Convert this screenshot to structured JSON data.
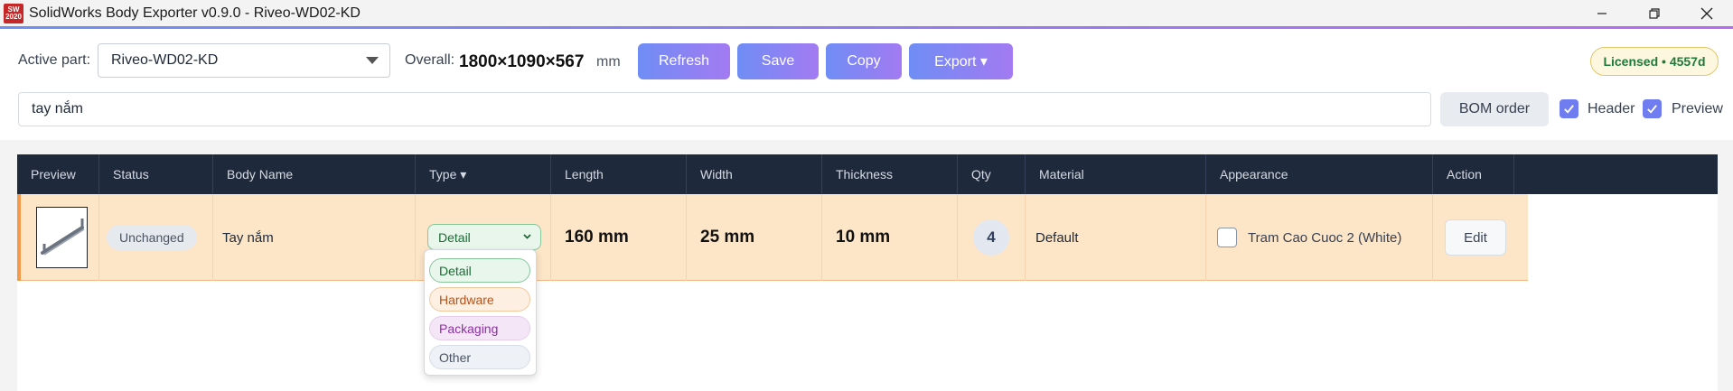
{
  "window": {
    "title": "SolidWorks Body Exporter v0.9.0 - Riveo-WD02-KD",
    "icon_text": "SW 2020",
    "controls": [
      "minimize-icon",
      "restore-icon",
      "close-icon"
    ]
  },
  "toolbar": {
    "active_part_label": "Active part:",
    "active_part_value": "Riveo-WD02-KD",
    "overall_label": "Overall:",
    "overall_value": "1800×1090×567",
    "overall_unit": "mm",
    "refresh_label": "Refresh",
    "save_label": "Save",
    "copy_label": "Copy",
    "export_label": "Export ▾",
    "license_badge": "Licensed • 4557d"
  },
  "search": {
    "value": "tay nắm"
  },
  "options": {
    "bom_order_label": "BOM order",
    "header_label": "Header",
    "header_checked": true,
    "preview_label": "Preview",
    "preview_checked": true
  },
  "table": {
    "columns": [
      "Preview",
      "Status",
      "Body Name",
      "Type ▾",
      "Length",
      "Width",
      "Thickness",
      "Qty",
      "Material",
      "Appearance",
      "Action"
    ],
    "rows": [
      {
        "status": "Unchanged",
        "body_name": "Tay nắm",
        "type": "Detail",
        "length": "160 mm",
        "width": "25 mm",
        "thickness": "10 mm",
        "qty": "4",
        "material": "Default",
        "appearance": "Tram Cao Cuoc 2 (White)",
        "appearance_checked": false,
        "action": "Edit"
      }
    ]
  },
  "type_dropdown": {
    "options": [
      "Detail",
      "Hardware",
      "Packaging",
      "Other"
    ]
  },
  "colors": {
    "accent_gradient_start": "#6f8df5",
    "accent_gradient_end": "#a37af2",
    "header_bg": "#1e293b",
    "selected_row_bg": "#fde5c8",
    "selected_row_accent": "#f29b4b"
  }
}
